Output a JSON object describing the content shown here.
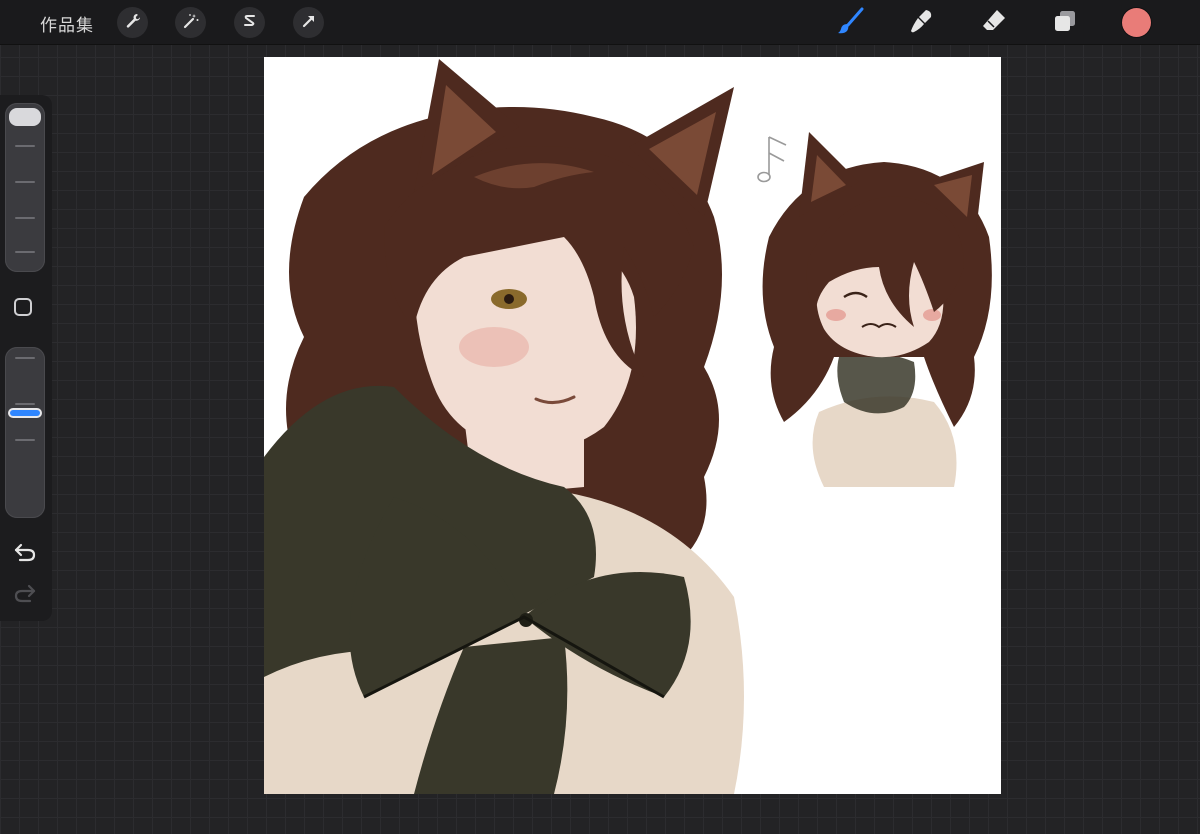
{
  "toolbar": {
    "gallery_label": "作品集",
    "actions": [
      "wrench-icon",
      "magic-wand-icon",
      "selection-icon",
      "transform-arrow-icon"
    ],
    "tools": [
      "brush-icon",
      "smudge-icon",
      "eraser-icon",
      "layers-icon"
    ],
    "active_tool": "brush-icon",
    "active_tool_color": "#2f86ff",
    "current_color": "#e97c78"
  },
  "sidebar": {
    "brush_size": 1.0,
    "brush_opacity": 0.62,
    "controls": [
      "modify-square-icon",
      "undo-icon",
      "redo-icon"
    ]
  },
  "canvas": {
    "background": "#ffffff",
    "palette": {
      "hair": "#4e2a1f",
      "hair_light": "#7a4a36",
      "skin": "#f2ddd3",
      "blush": "#e7a9a0",
      "scarf": "#39382a",
      "sweater": "#e7d8c8",
      "eye": "#8a6a2c"
    }
  }
}
